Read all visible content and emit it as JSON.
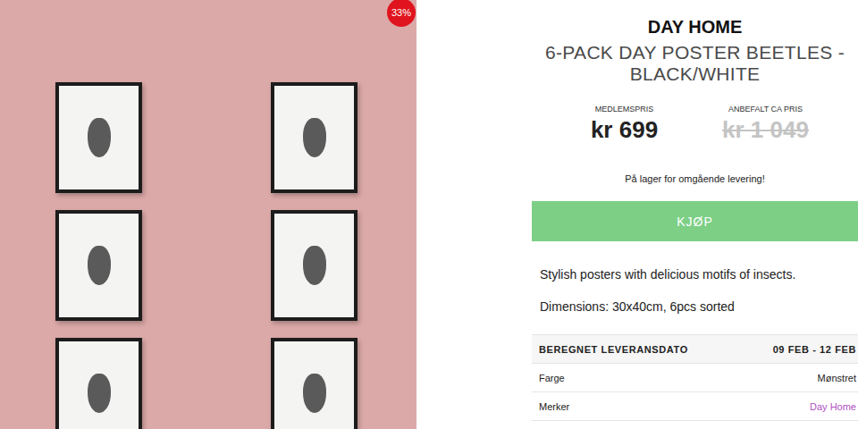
{
  "product_image": {
    "discount_badge": "33%"
  },
  "brand": "DAY HOME",
  "title": "6-PACK DAY POSTER BEETLES - BLACK/WHITE",
  "prices": [
    {
      "label": "MEDLEMSPRIS",
      "amount": "kr 699",
      "struck": false
    },
    {
      "label": "ANBEFALT CA PRIS",
      "amount": "kr 1 049",
      "struck": true
    }
  ],
  "stock": "På lager for omgående levering!",
  "buy_button": "KJØP",
  "description": [
    "Stylish posters with delicious motifs of insects.",
    "Dimensions: 30x40cm, 6pcs sorted"
  ],
  "details": [
    {
      "label": "BEREGNET LEVERANSDATO",
      "value": "09 FEB - 12 FEB",
      "kind": "header"
    },
    {
      "label": "Farge",
      "value": "Mønstret",
      "kind": "plain"
    },
    {
      "label": "Merker",
      "value": "Day Home",
      "kind": "link"
    }
  ]
}
